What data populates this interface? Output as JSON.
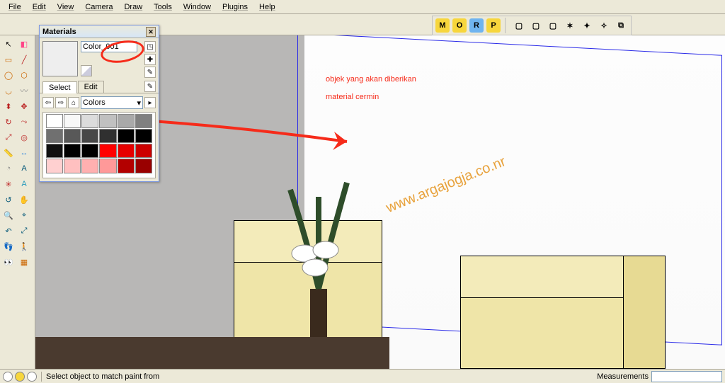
{
  "menubar": [
    "File",
    "Edit",
    "View",
    "Camera",
    "Draw",
    "Tools",
    "Window",
    "Plugins",
    "Help"
  ],
  "vray_buttons": [
    {
      "name": "m",
      "label": "M",
      "bg": "#f7d63c"
    },
    {
      "name": "o",
      "label": "O",
      "bg": "#f7d63c"
    },
    {
      "name": "r",
      "label": "R",
      "bg": "#6fb4f0"
    },
    {
      "name": "p",
      "label": "P",
      "bg": "#f7d63c"
    }
  ],
  "tools": [
    {
      "name": "select",
      "glyph": "↖",
      "c": "#000"
    },
    {
      "name": "eraser",
      "glyph": "◧",
      "c": "#f48"
    },
    {
      "name": "rectangle",
      "glyph": "▭",
      "c": "#c60"
    },
    {
      "name": "line",
      "glyph": "╱",
      "c": "#b22"
    },
    {
      "name": "circle",
      "glyph": "◯",
      "c": "#c60"
    },
    {
      "name": "polygon",
      "glyph": "⬡",
      "c": "#c60"
    },
    {
      "name": "arc",
      "glyph": "◡",
      "c": "#c60"
    },
    {
      "name": "freehand",
      "glyph": "〰",
      "c": "#888"
    },
    {
      "name": "pushpull",
      "glyph": "⬍",
      "c": "#b22"
    },
    {
      "name": "move",
      "glyph": "✥",
      "c": "#b22"
    },
    {
      "name": "rotate",
      "glyph": "↻",
      "c": "#b22"
    },
    {
      "name": "followme",
      "glyph": "⤳",
      "c": "#b22"
    },
    {
      "name": "scale",
      "glyph": "⤢",
      "c": "#b22"
    },
    {
      "name": "offset",
      "glyph": "◎",
      "c": "#b22"
    },
    {
      "name": "tape",
      "glyph": "📏",
      "c": "#888"
    },
    {
      "name": "dimension",
      "glyph": "↔",
      "c": "#38d"
    },
    {
      "name": "protractor",
      "glyph": "◔",
      "c": "#888"
    },
    {
      "name": "text",
      "glyph": "A",
      "c": "#057"
    },
    {
      "name": "axes",
      "glyph": "✳",
      "c": "#b22"
    },
    {
      "name": "3dtext",
      "glyph": "A",
      "c": "#29b"
    },
    {
      "name": "orbit",
      "glyph": "↺",
      "c": "#057"
    },
    {
      "name": "pan",
      "glyph": "✋",
      "c": "#c93"
    },
    {
      "name": "zoom",
      "glyph": "🔍",
      "c": "#057"
    },
    {
      "name": "zoomwindow",
      "glyph": "⌖",
      "c": "#057"
    },
    {
      "name": "previous",
      "glyph": "↶",
      "c": "#057"
    },
    {
      "name": "zoomextents",
      "glyph": "⤢",
      "c": "#057"
    },
    {
      "name": "position",
      "glyph": "👣",
      "c": "#000"
    },
    {
      "name": "walk",
      "glyph": "🚶",
      "c": "#000"
    },
    {
      "name": "look",
      "glyph": "👀",
      "c": "#057"
    },
    {
      "name": "section",
      "glyph": "▦",
      "c": "#c60"
    }
  ],
  "materials_panel": {
    "title": "Materials",
    "current_name": "Color_001",
    "tabs": {
      "select": "Select",
      "edit": "Edit"
    },
    "library": "Colors",
    "swatches": [
      "#ffffff",
      "#f8f8f8",
      "#dcdcdc",
      "#c0c0c0",
      "#a9a9a9",
      "#808080",
      "#707070",
      "#585858",
      "#484848",
      "#303030",
      "#000000",
      "#000000",
      "#101010",
      "#000000",
      "#000000",
      "#ff0000",
      "#e60000",
      "#cc0000",
      "#ffd0d0",
      "#ffc0c0",
      "#ffb0b0",
      "#ff9999",
      "#b30000",
      "#990000"
    ]
  },
  "annotation": {
    "line1": "objek yang akan diberikan",
    "line2": "material cermin"
  },
  "watermark": "www.argajogja.co.nr",
  "statusbar": {
    "hint": "Select object to match paint from",
    "measurements_label": "Measurements"
  }
}
